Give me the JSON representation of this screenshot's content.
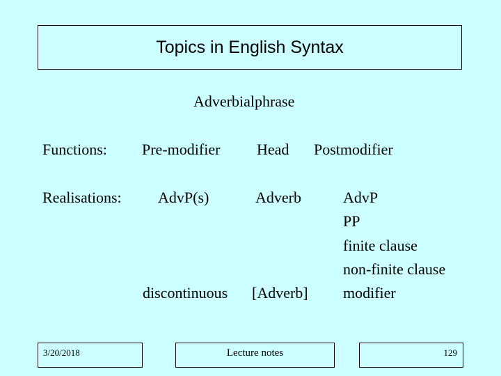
{
  "slide": {
    "title": "Topics in English Syntax",
    "subtitle": "Adverbialphrase",
    "functions": {
      "label": "Functions:",
      "pre_modifier": "Pre-modifier",
      "head": "Head",
      "post_modifier": "Postmodifier"
    },
    "realisations": {
      "label": "Realisations:",
      "pre_modifier": "AdvP(s)",
      "head": "Adverb",
      "post_modifier_items": [
        "AdvP",
        "PP",
        "finite clause",
        "non-finite clause",
        "modifier"
      ],
      "discontinuous": "discontinuous",
      "head_discontinuous": "[Adverb]"
    },
    "background_color": "#CCFFFF"
  },
  "footer": {
    "date": "3/20/2018",
    "center": "Lecture notes",
    "page_number": "129"
  }
}
